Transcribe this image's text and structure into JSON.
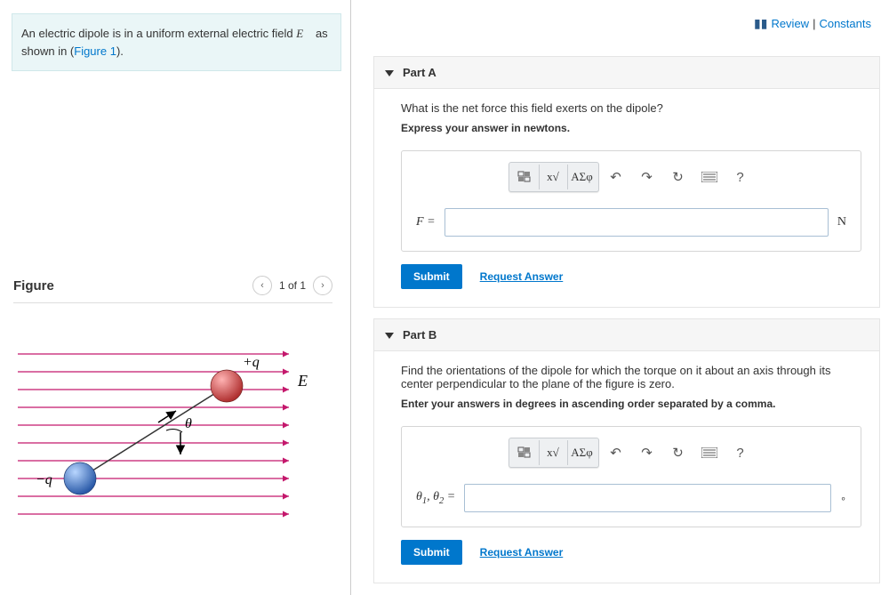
{
  "problem": {
    "text_prefix": "An electric dipole is in a uniform external electric field ",
    "text_suffix": " as shown in (",
    "figure_link": "Figure 1",
    "text_end": ")."
  },
  "figure_panel": {
    "title": "Figure",
    "counter": "1 of 1"
  },
  "top_links": {
    "review": "Review",
    "separator": "|",
    "constants": "Constants"
  },
  "partA": {
    "header": "Part A",
    "question": "What is the net force this field exerts on the dipole?",
    "instruction": "Express your answer in newtons.",
    "input_prefix": "F = ",
    "unit": "N",
    "submit": "Submit",
    "request": "Request Answer",
    "toolbar": {
      "greek": "ΑΣφ",
      "help": "?"
    }
  },
  "partB": {
    "header": "Part B",
    "question": "Find the orientations of the dipole for which the torque on it about an axis through its center perpendicular to the plane of the figure is zero.",
    "instruction": "Enter your answers in degrees in ascending order separated by a comma.",
    "input_prefix_html": "θ₁, θ₂ = ",
    "unit": "∘",
    "submit": "Submit",
    "request": "Request Answer",
    "toolbar": {
      "greek": "ΑΣφ",
      "help": "?"
    }
  },
  "figure_labels": {
    "pos_q": "+q",
    "neg_q": "−q",
    "field": "E",
    "theta": "θ"
  }
}
